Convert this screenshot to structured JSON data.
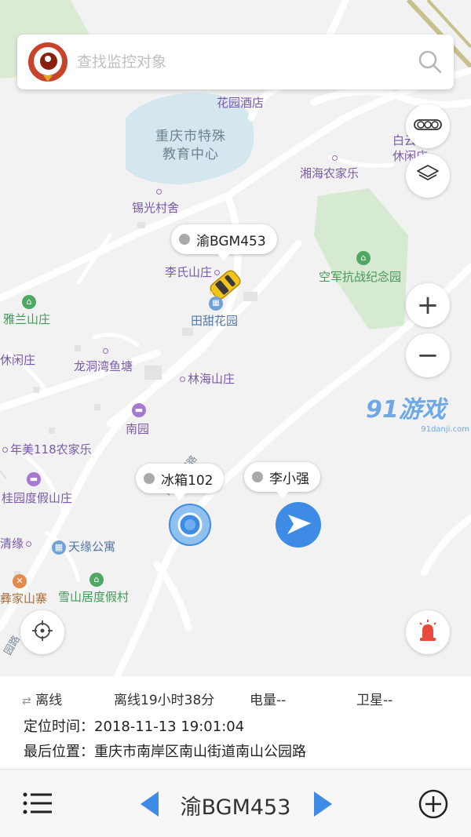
{
  "search": {
    "placeholder": "查找监控对象"
  },
  "map": {
    "water_label": "重庆市特殊\n教育中心",
    "pois": {
      "huayuan_hotel": "花园酒店",
      "baiyun_leisure": "白云山",
      "xiuxian": "休闲庄",
      "xianghai": "湘海农家乐",
      "xiguang": "锡光村舍",
      "lishi": "李氏山庄",
      "tiantian": "田甜花园",
      "kongjun": "空军抗战纪念园",
      "yalan": "雅兰山庄",
      "xiuxianzhuang": "休闲庄",
      "longdong": "龙洞湾鱼塘",
      "linhai": "林海山庄",
      "nanyuan": "南园",
      "nianmei": "年美118农家乐",
      "guiyuan": "桂园度假山庄",
      "qingyuan": "清缘",
      "tianyuan": "天缘公寓",
      "xueshan": "雪山居度假村",
      "yijia": "彝家山寨",
      "road_nanshan": "南山公园路",
      "road_yuanlu": "园路"
    },
    "watermark": {
      "brand": "91游戏",
      "domain": "91danji.com"
    }
  },
  "vehicles": [
    {
      "label": "渝BGM453",
      "status": "offline"
    },
    {
      "label": "冰箱102",
      "status": "offline"
    },
    {
      "label": "李小强",
      "status": "offline"
    }
  ],
  "controls": {
    "traffic_icon": "traffic-light-icon",
    "layers_icon": "layers-icon",
    "zoom_in": "+",
    "zoom_out": "−",
    "locate_icon": "crosshair-icon",
    "alarm_icon": "siren-icon"
  },
  "info": {
    "connection_icon": "swap-arrows-icon",
    "status": "离线",
    "offline_duration": "离线19小时38分",
    "battery": "电量--",
    "satellite": "卫星--",
    "locate_time_label": "定位时间：",
    "locate_time": "2018-11-13 19:01:04",
    "last_position_label": "最后位置：",
    "last_position": "重庆市南岸区南山街道南山公园路"
  },
  "bottom": {
    "current_device": "渝BGM453",
    "menu_icon": "list-icon",
    "prev_icon": "triangle-left-icon",
    "next_icon": "triangle-right-icon",
    "add_icon": "plus-circle-icon"
  },
  "colors": {
    "accent_blue": "#3d8be5",
    "brand_red": "#c7442a",
    "alarm_red": "#e84b3c",
    "park_green": "#d6ead2",
    "water_blue": "#d4e6ee"
  }
}
